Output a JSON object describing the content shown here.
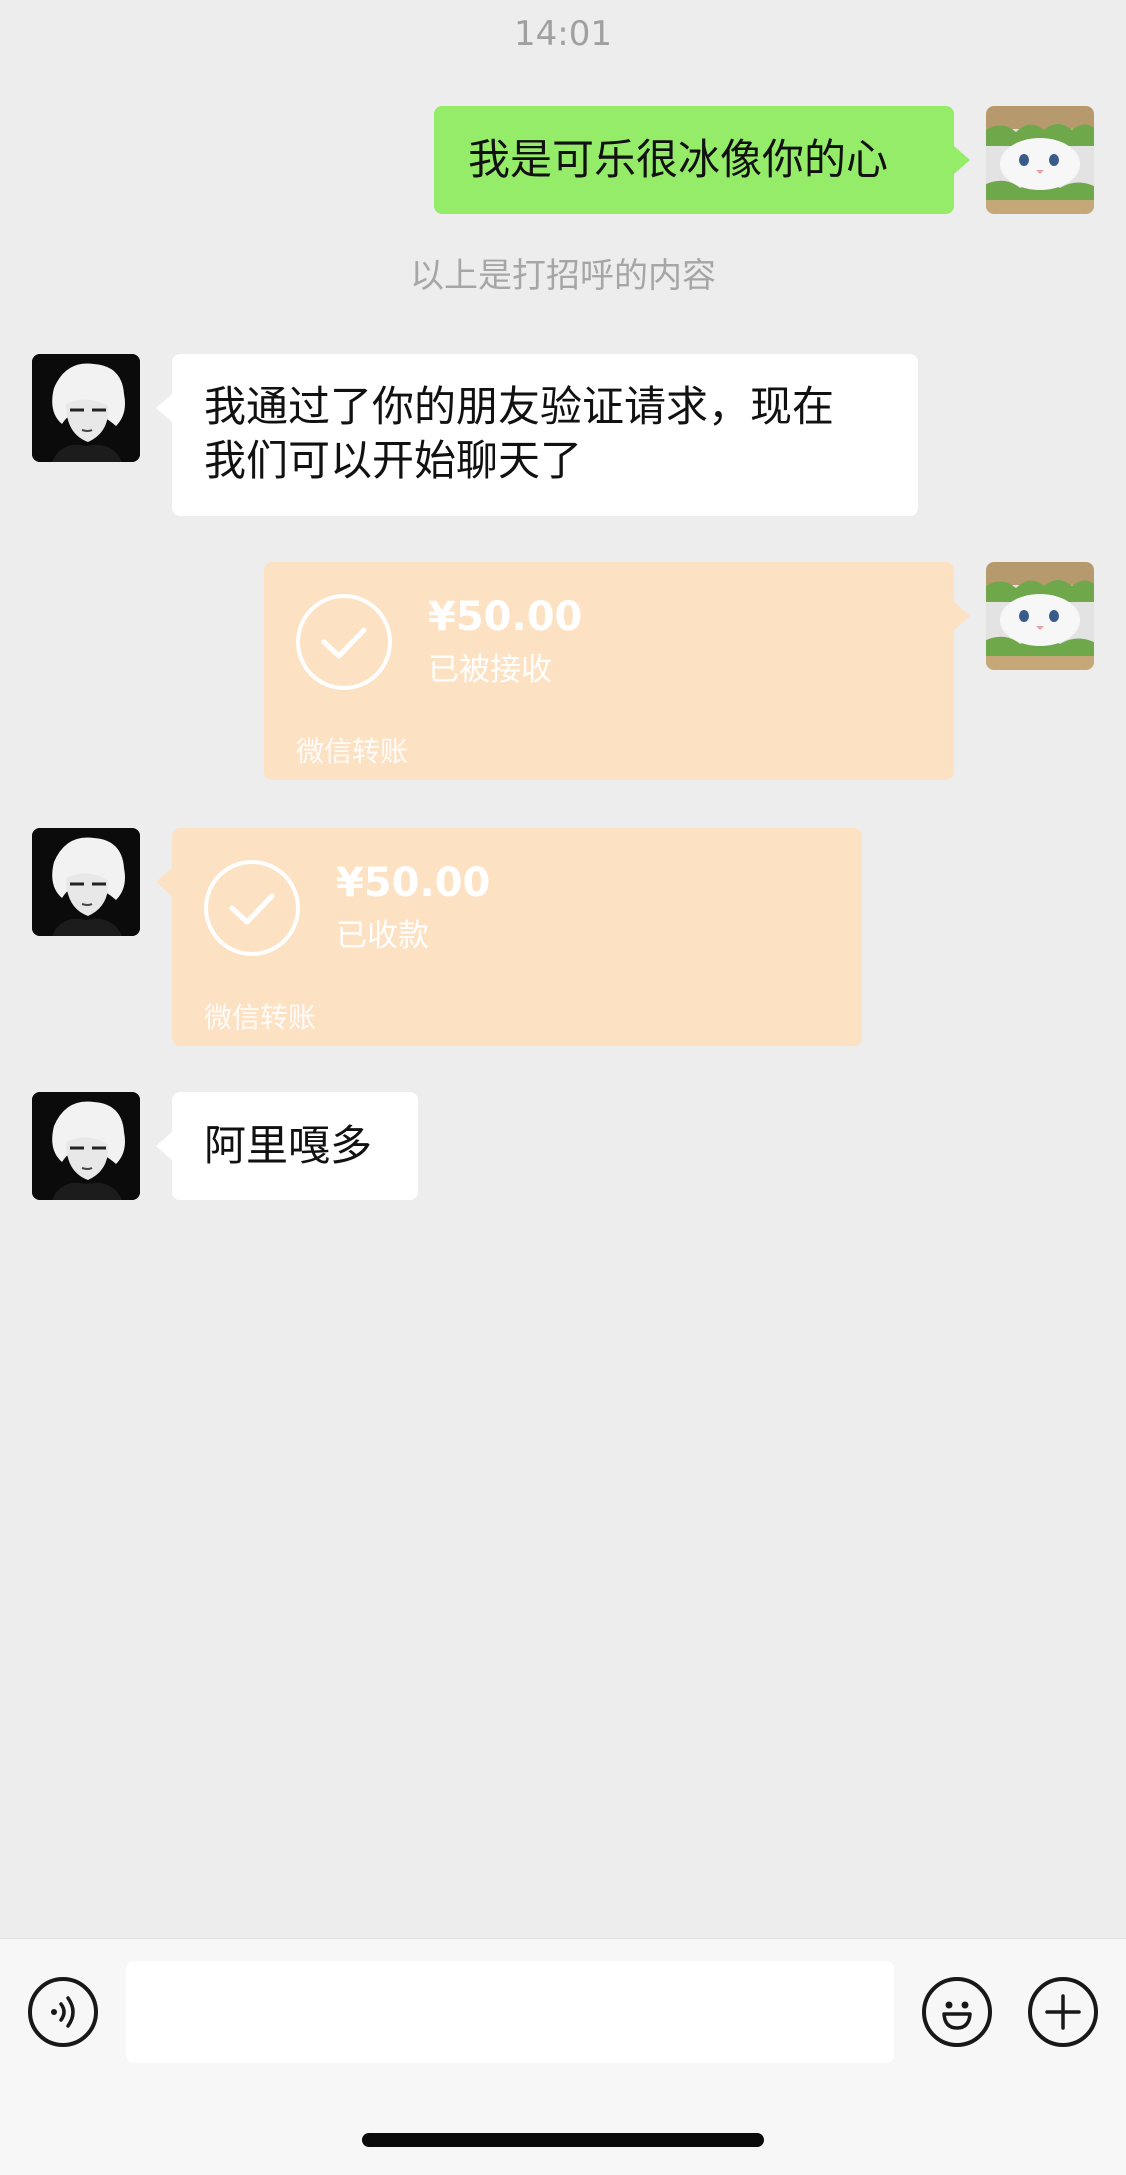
{
  "timestamp": "14:01",
  "messages": {
    "m1": {
      "text": "我是可乐很冰像你的心",
      "sender": "me",
      "bubble_color": "#95ec69"
    },
    "system": {
      "text": "以上是打招呼的内容"
    },
    "m2": {
      "line1": "我通过了你的朋友验证请求，现在",
      "line2": "我们可以开始聊天了",
      "sender": "contact"
    },
    "m3": {
      "amount": "¥50.00",
      "status": "已被接收",
      "footer": "微信转账",
      "sender": "me",
      "bubble_color": "#fde1c3"
    },
    "m4": {
      "amount": "¥50.00",
      "status": "已收款",
      "footer": "微信转账",
      "sender": "contact",
      "bubble_color": "#fde1c3"
    },
    "m5": {
      "text": "阿里嘎多",
      "sender": "contact"
    }
  },
  "input_bar": {
    "message_value": "",
    "icons": [
      "voice-icon",
      "emoji-icon",
      "add-icon"
    ]
  },
  "colors": {
    "background": "#ededed",
    "green_bubble": "#95ec69",
    "transfer_bubble": "#fde1c3"
  }
}
